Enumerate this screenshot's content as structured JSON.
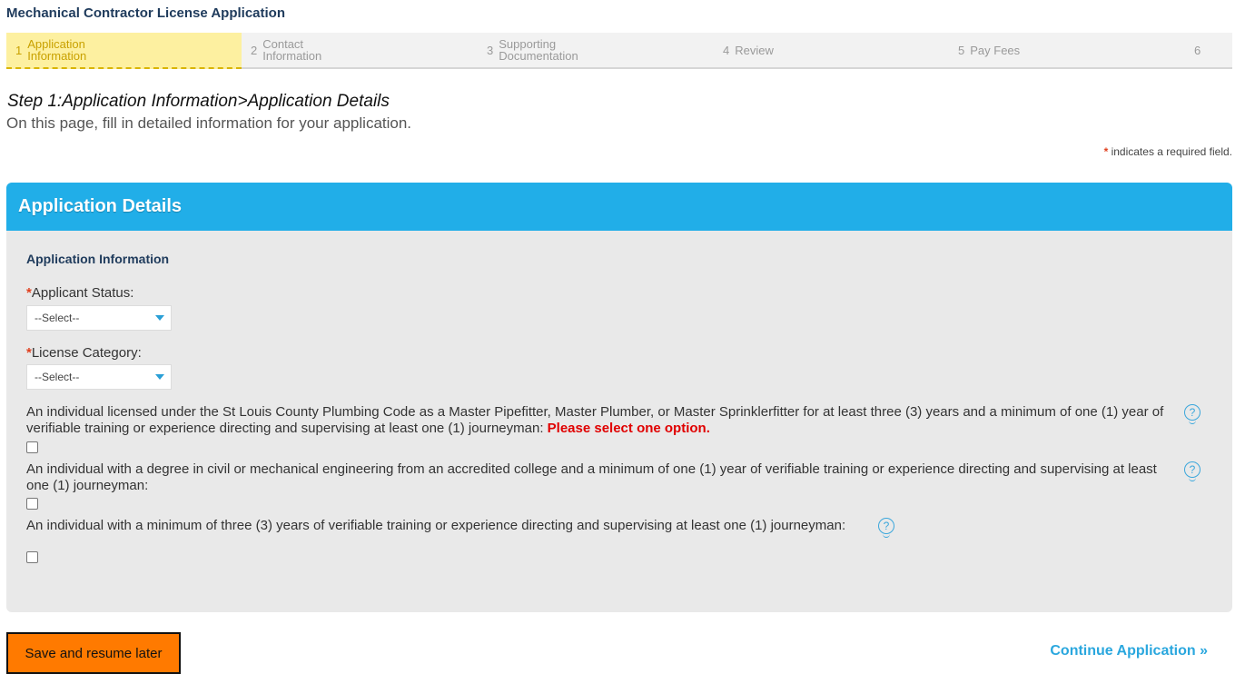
{
  "page": {
    "title": "Mechanical Contractor License Application"
  },
  "stepper": {
    "steps": [
      {
        "num": "1",
        "label": "Application Information"
      },
      {
        "num": "2",
        "label": "Contact Information"
      },
      {
        "num": "3",
        "label": "Supporting Documentation"
      },
      {
        "num": "4",
        "label": "Review"
      },
      {
        "num": "5",
        "label": "Pay Fees"
      },
      {
        "num": "6",
        "label": ""
      }
    ],
    "active_index": 0
  },
  "heading": {
    "title": "Step 1:Application Information>Application Details",
    "subtitle": "On this page, fill in detailed information for your application."
  },
  "required_note": {
    "star": "*",
    "text": "indicates a required field."
  },
  "panel": {
    "header": "Application Details",
    "section_title": "Application Information",
    "applicant_status": {
      "label": "Applicant Status:",
      "value": "--Select--"
    },
    "license_category": {
      "label": "License Category:",
      "value": "--Select--"
    },
    "questions": [
      {
        "text": "An individual licensed under the St Louis County Plumbing Code as a Master Pipefitter, Master Plumber, or Master Sprinklerfitter for at least three (3) years and a minimum of one (1) year of verifiable training or experience directing and supervising at least one (1) journeyman:",
        "error": "Please select one option."
      },
      {
        "text": "An individual with a degree in civil or mechanical engineering from an accredited college and a minimum of one (1) year of verifiable training or experience directing and supervising at least one (1) journeyman:",
        "error": ""
      },
      {
        "text": "An individual with a minimum of three (3) years of verifiable training or experience directing and supervising at least one (1) journeyman:",
        "error": ""
      }
    ],
    "help_glyph": "?"
  },
  "footer": {
    "save_label": "Save and resume later",
    "continue_label": "Continue Application »"
  },
  "colors": {
    "accent_blue": "#21aee8",
    "active_step_bg": "#fdf0a0",
    "save_button": "#ff7a00",
    "error": "#e00000"
  },
  "icons": {
    "help": "help-icon",
    "dropdown": "chevron-down-icon"
  }
}
